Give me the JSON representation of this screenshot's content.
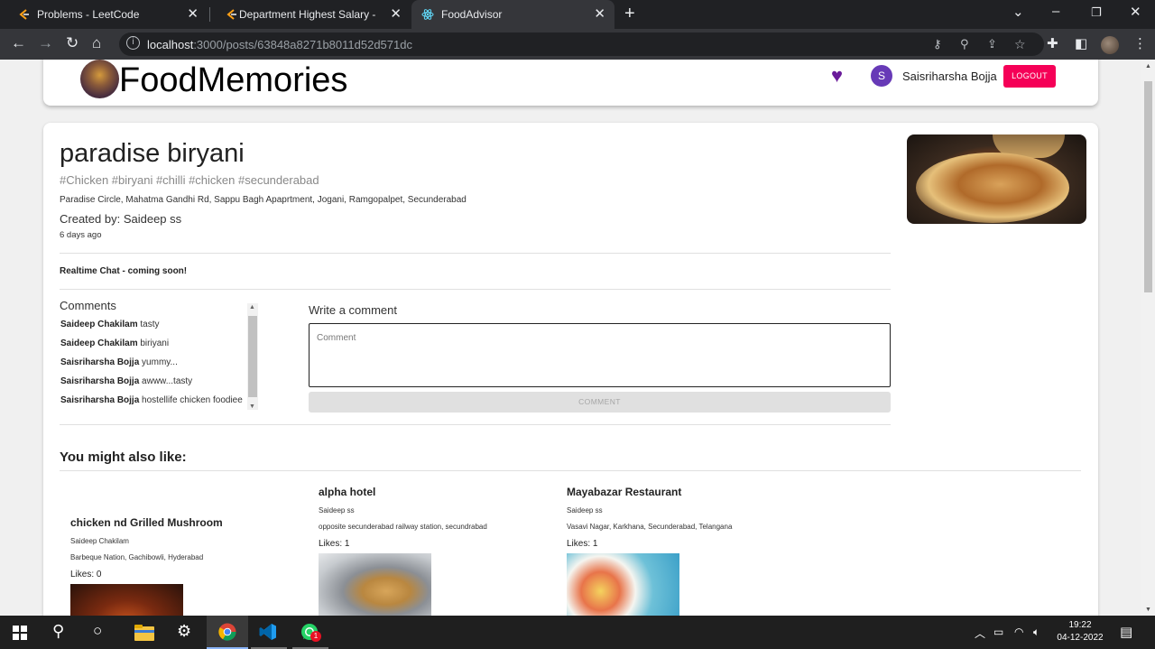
{
  "browser": {
    "tabs": [
      {
        "title": "Problems - LeetCode",
        "close": "✕"
      },
      {
        "title": "Department Highest Salary - Leet",
        "close": "✕"
      },
      {
        "title": "FoodAdvisor",
        "close": "✕"
      }
    ],
    "url_host": "localhost",
    "url_rest": ":3000/posts/63848a8271b8011d52d571dc"
  },
  "header": {
    "brand": "FoodMemories",
    "avatar_initial": "S",
    "username": "Saisriharsha Bojja",
    "logout_label": "LOGOUT"
  },
  "post": {
    "title": "paradise biryani",
    "tags": "#Chicken #biryani #chilli #chicken #secunderabad",
    "address": "Paradise Circle, Mahatma Gandhi Rd, Sappu Bagh Apaprtment, Jogani, Ramgopalpet, Secunderabad",
    "created_by": "Created by: Saideep ss",
    "ago": "6 days ago",
    "realtime_chat": "Realtime Chat - coming soon!"
  },
  "comments": {
    "heading": "Comments",
    "items": [
      {
        "author": "Saideep Chakilam",
        "text": "tasty"
      },
      {
        "author": "Saideep Chakilam",
        "text": "biriyani"
      },
      {
        "author": "Saisriharsha Bojja",
        "text": "yummy..."
      },
      {
        "author": "Saisriharsha Bojja",
        "text": "awww...tasty"
      },
      {
        "author": "Saisriharsha Bojja",
        "text": "hostellife chicken foodiee"
      }
    ],
    "write_heading": "Write a comment",
    "placeholder": "Comment",
    "submit_label": "COMMENT"
  },
  "recommendations": {
    "heading": "You might also like:",
    "items": [
      {
        "name": "chicken nd Grilled Mushroom",
        "author": "Saideep Chakilam",
        "address": "Barbeque Nation, Gachibowli, Hyderabad",
        "likes": "Likes: 0"
      },
      {
        "name": "alpha hotel",
        "author": "Saideep ss",
        "address": "opposite secunderabad railway station, secundrabad",
        "likes": "Likes: 1"
      },
      {
        "name": "Mayabazar Restaurant",
        "author": "Saideep ss",
        "address": "Vasavi Nagar, Karkhana, Secunderabad, Telangana",
        "likes": "Likes: 1"
      }
    ]
  },
  "taskbar": {
    "time": "19:22",
    "date": "04-12-2022",
    "whatsapp_badge": "1"
  },
  "colors": {
    "logout": "#f50057",
    "avatar": "#673ab7",
    "heart": "#6a1b9a"
  }
}
